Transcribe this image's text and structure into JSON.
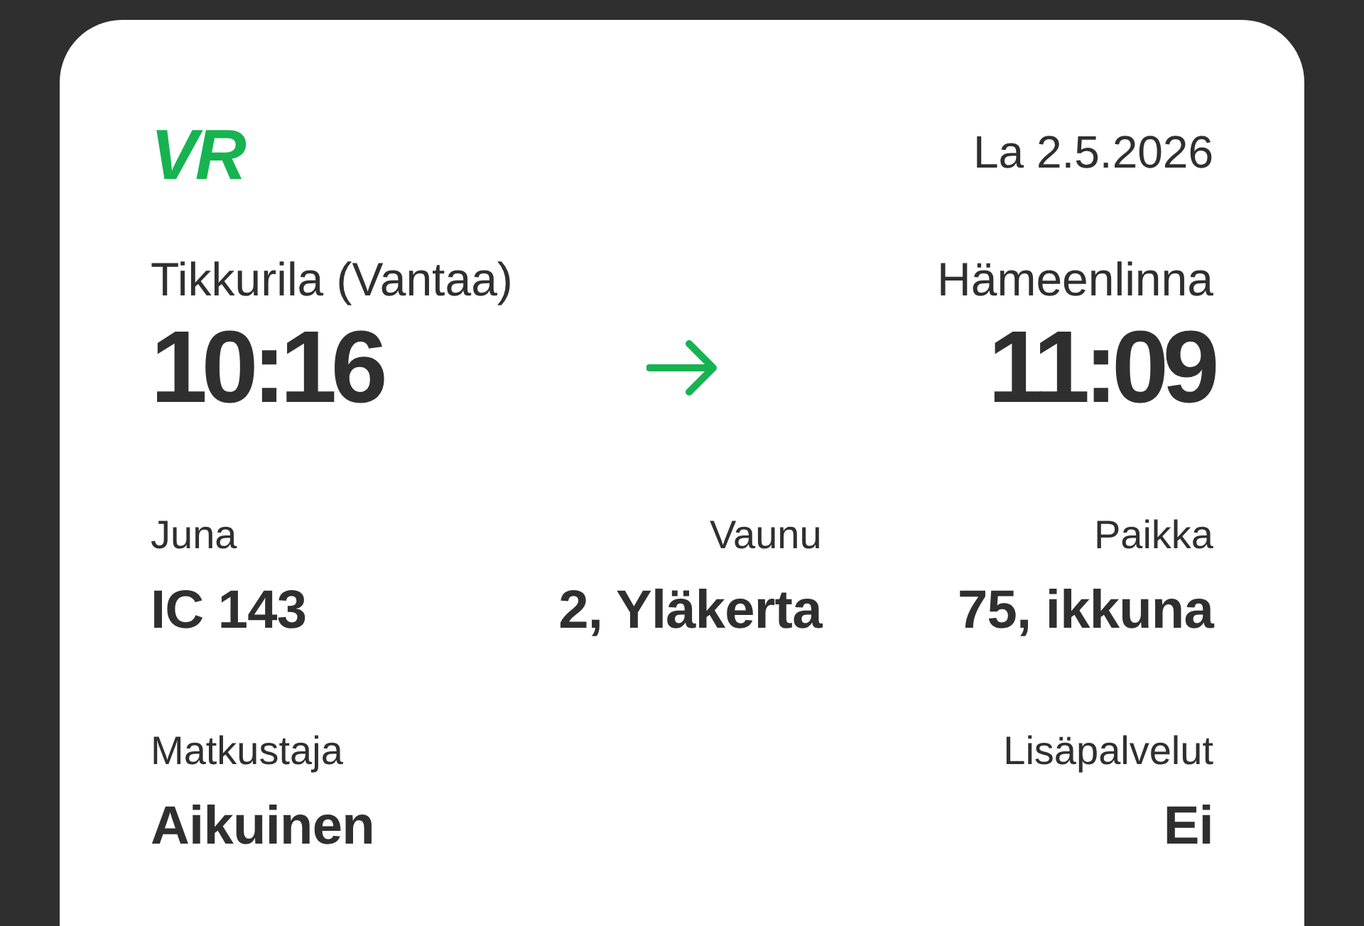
{
  "logo": {
    "text": "VR"
  },
  "date": "La 2.5.2026",
  "journey": {
    "departure": {
      "station": "Tikkurila (Vantaa)",
      "time": "10:16"
    },
    "arrival": {
      "station": "Hämeenlinna",
      "time": "11:09"
    }
  },
  "details": [
    {
      "label": "Juna",
      "value": "IC 143"
    },
    {
      "label": "Vaunu",
      "value": "2, Yläkerta"
    },
    {
      "label": "Paikka",
      "value": "75, ikkuna"
    }
  ],
  "passenger": [
    {
      "label": "Matkustaja",
      "value": "Aikuinen"
    },
    {
      "label": "Lisäpalvelut",
      "value": "Ei"
    }
  ]
}
